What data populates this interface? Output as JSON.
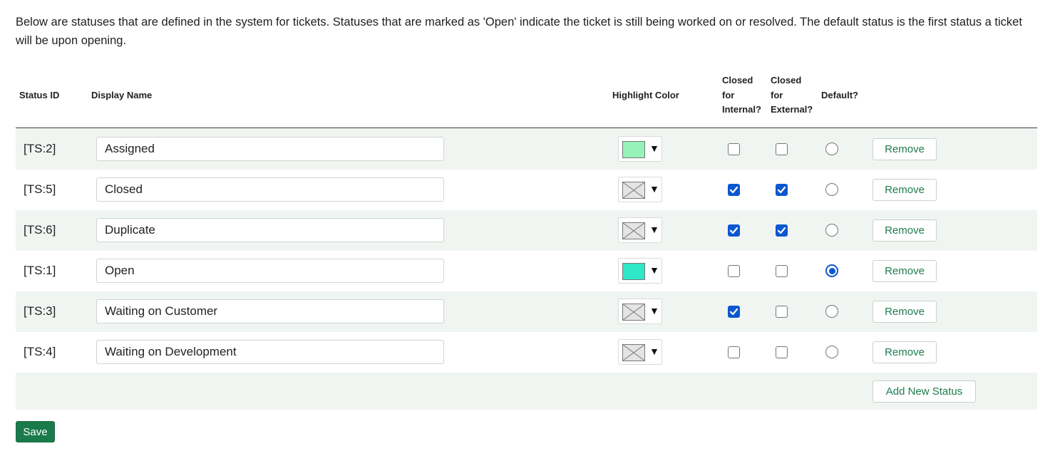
{
  "intro_text": "Below are statuses that are defined in the system for tickets. Statuses that are marked as 'Open' indicate the ticket is still being worked on or resolved. The default status is the first status a ticket will be upon opening.",
  "columns": {
    "status_id": "Status ID",
    "display_name": "Display Name",
    "highlight_color": "Highlight Color",
    "closed_internal": [
      "Closed",
      "for",
      "Internal?"
    ],
    "closed_external": [
      "Closed",
      "for",
      "External?"
    ],
    "default": "Default?"
  },
  "statuses": [
    {
      "id": "[TS:2]",
      "name": "Assigned",
      "color": "#96f2b8",
      "closed_internal": false,
      "closed_external": false,
      "default": false,
      "remove_label": "Remove"
    },
    {
      "id": "[TS:5]",
      "name": "Closed",
      "color": null,
      "closed_internal": true,
      "closed_external": true,
      "default": false,
      "remove_label": "Remove"
    },
    {
      "id": "[TS:6]",
      "name": "Duplicate",
      "color": null,
      "closed_internal": true,
      "closed_external": true,
      "default": false,
      "remove_label": "Remove"
    },
    {
      "id": "[TS:1]",
      "name": "Open",
      "color": "#2ee8c8",
      "closed_internal": false,
      "closed_external": false,
      "default": true,
      "remove_label": "Remove"
    },
    {
      "id": "[TS:3]",
      "name": "Waiting on Customer",
      "color": null,
      "closed_internal": true,
      "closed_external": false,
      "default": false,
      "remove_label": "Remove"
    },
    {
      "id": "[TS:4]",
      "name": "Waiting on Development",
      "color": null,
      "closed_internal": false,
      "closed_external": false,
      "default": false,
      "remove_label": "Remove"
    }
  ],
  "color_picker_caret": "▼",
  "add_new_status_label": "Add New Status",
  "save_label": "Save",
  "colors": {
    "accent_green": "#1a7a4c",
    "checkbox_blue": "#0b57d0",
    "row_alt": "#f0f5f2"
  }
}
